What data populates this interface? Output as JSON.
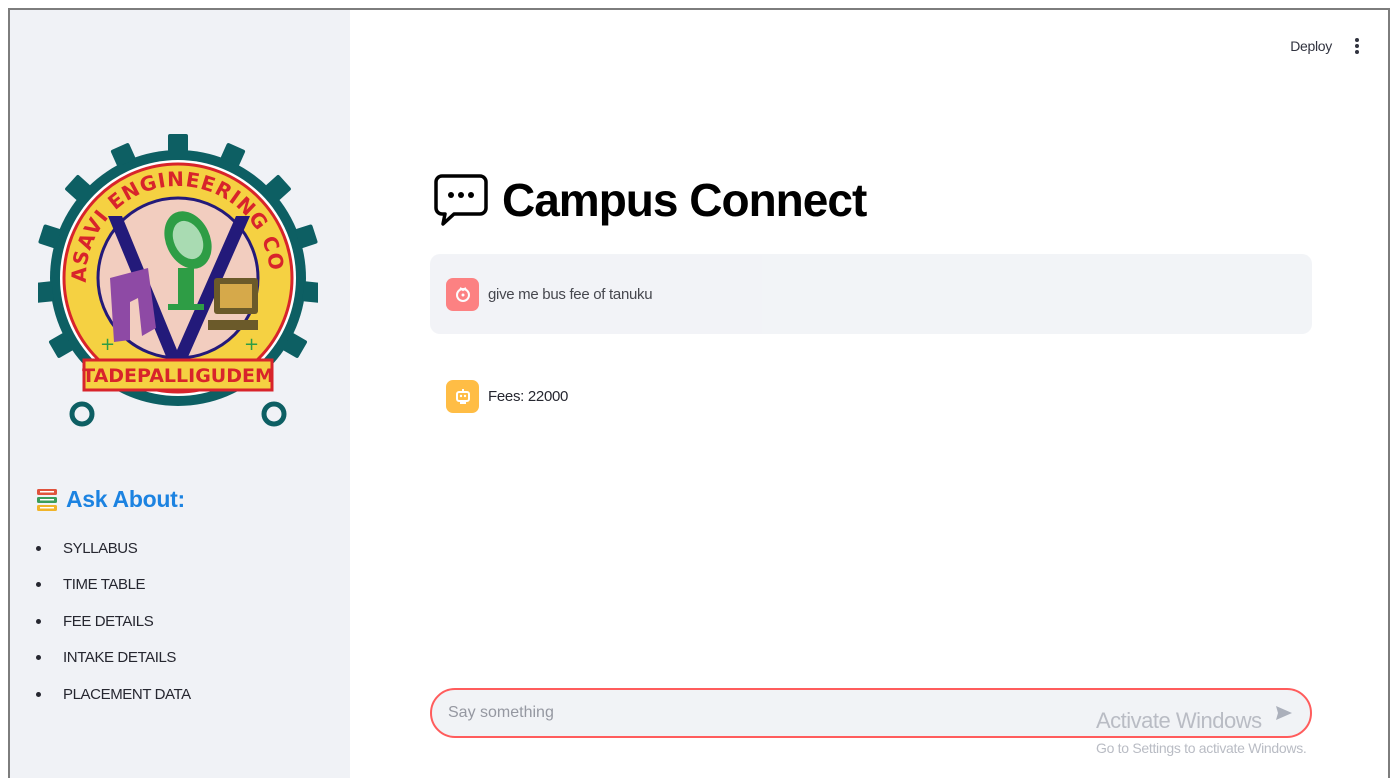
{
  "header": {
    "deploy_label": "Deploy"
  },
  "sidebar": {
    "logo": {
      "ring_text": "SRI VASAVI ENGINEERING COLLEGE",
      "banner_text": "TADEPALLIGUDEM"
    },
    "ask_title": "Ask About:",
    "items": [
      {
        "label": "SYLLABUS"
      },
      {
        "label": "TIME TABLE"
      },
      {
        "label": "FEE DETAILS"
      },
      {
        "label": "INTAKE DETAILS"
      },
      {
        "label": "PLACEMENT DATA"
      }
    ]
  },
  "main": {
    "title": "Campus Connect",
    "messages": [
      {
        "role": "user",
        "text": "give me bus fee of tanuku"
      },
      {
        "role": "assistant",
        "text": "Fees: 22000"
      }
    ],
    "chat_input": {
      "placeholder": "Say something"
    }
  },
  "watermark": {
    "line1": "Activate Windows",
    "line2": "Go to Settings to activate Windows."
  },
  "colors": {
    "accent": "#ff4b4b",
    "link_blue": "#1c83e1",
    "sidebar_bg": "#f0f2f6",
    "bot_avatar": "#ffbd45",
    "logo_teal": "#0d5f63",
    "logo_yellow": "#f5d142",
    "logo_red": "#d8242b",
    "logo_pink": "#f2cdbf",
    "logo_purple": "#8e4aa5",
    "logo_navy": "#231a7a",
    "logo_green": "#2e9d45"
  }
}
